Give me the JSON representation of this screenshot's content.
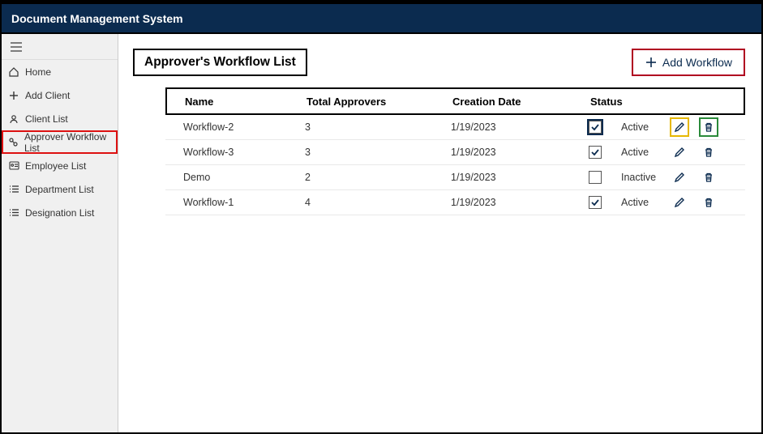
{
  "app": {
    "title": "Document Management System"
  },
  "sidebar": {
    "items": [
      {
        "label": "Home"
      },
      {
        "label": "Add Client"
      },
      {
        "label": "Client List"
      },
      {
        "label": "Approver Workflow List"
      },
      {
        "label": "Employee List"
      },
      {
        "label": "Department List"
      },
      {
        "label": "Designation List"
      }
    ]
  },
  "page": {
    "title": "Approver's Workflow List",
    "add_button": "Add Workflow"
  },
  "table": {
    "headers": {
      "name": "Name",
      "approvers": "Total Approvers",
      "created": "Creation Date",
      "status": "Status"
    },
    "rows": [
      {
        "name": "Workflow-2",
        "approvers": "3",
        "created": "1/19/2023",
        "active": true,
        "status_label": "Active"
      },
      {
        "name": "Workflow-3",
        "approvers": "3",
        "created": "1/19/2023",
        "active": true,
        "status_label": "Active"
      },
      {
        "name": "Demo",
        "approvers": "2",
        "created": "1/19/2023",
        "active": false,
        "status_label": "Inactive"
      },
      {
        "name": "Workflow-1",
        "approvers": "4",
        "created": "1/19/2023",
        "active": true,
        "status_label": "Active"
      }
    ]
  }
}
